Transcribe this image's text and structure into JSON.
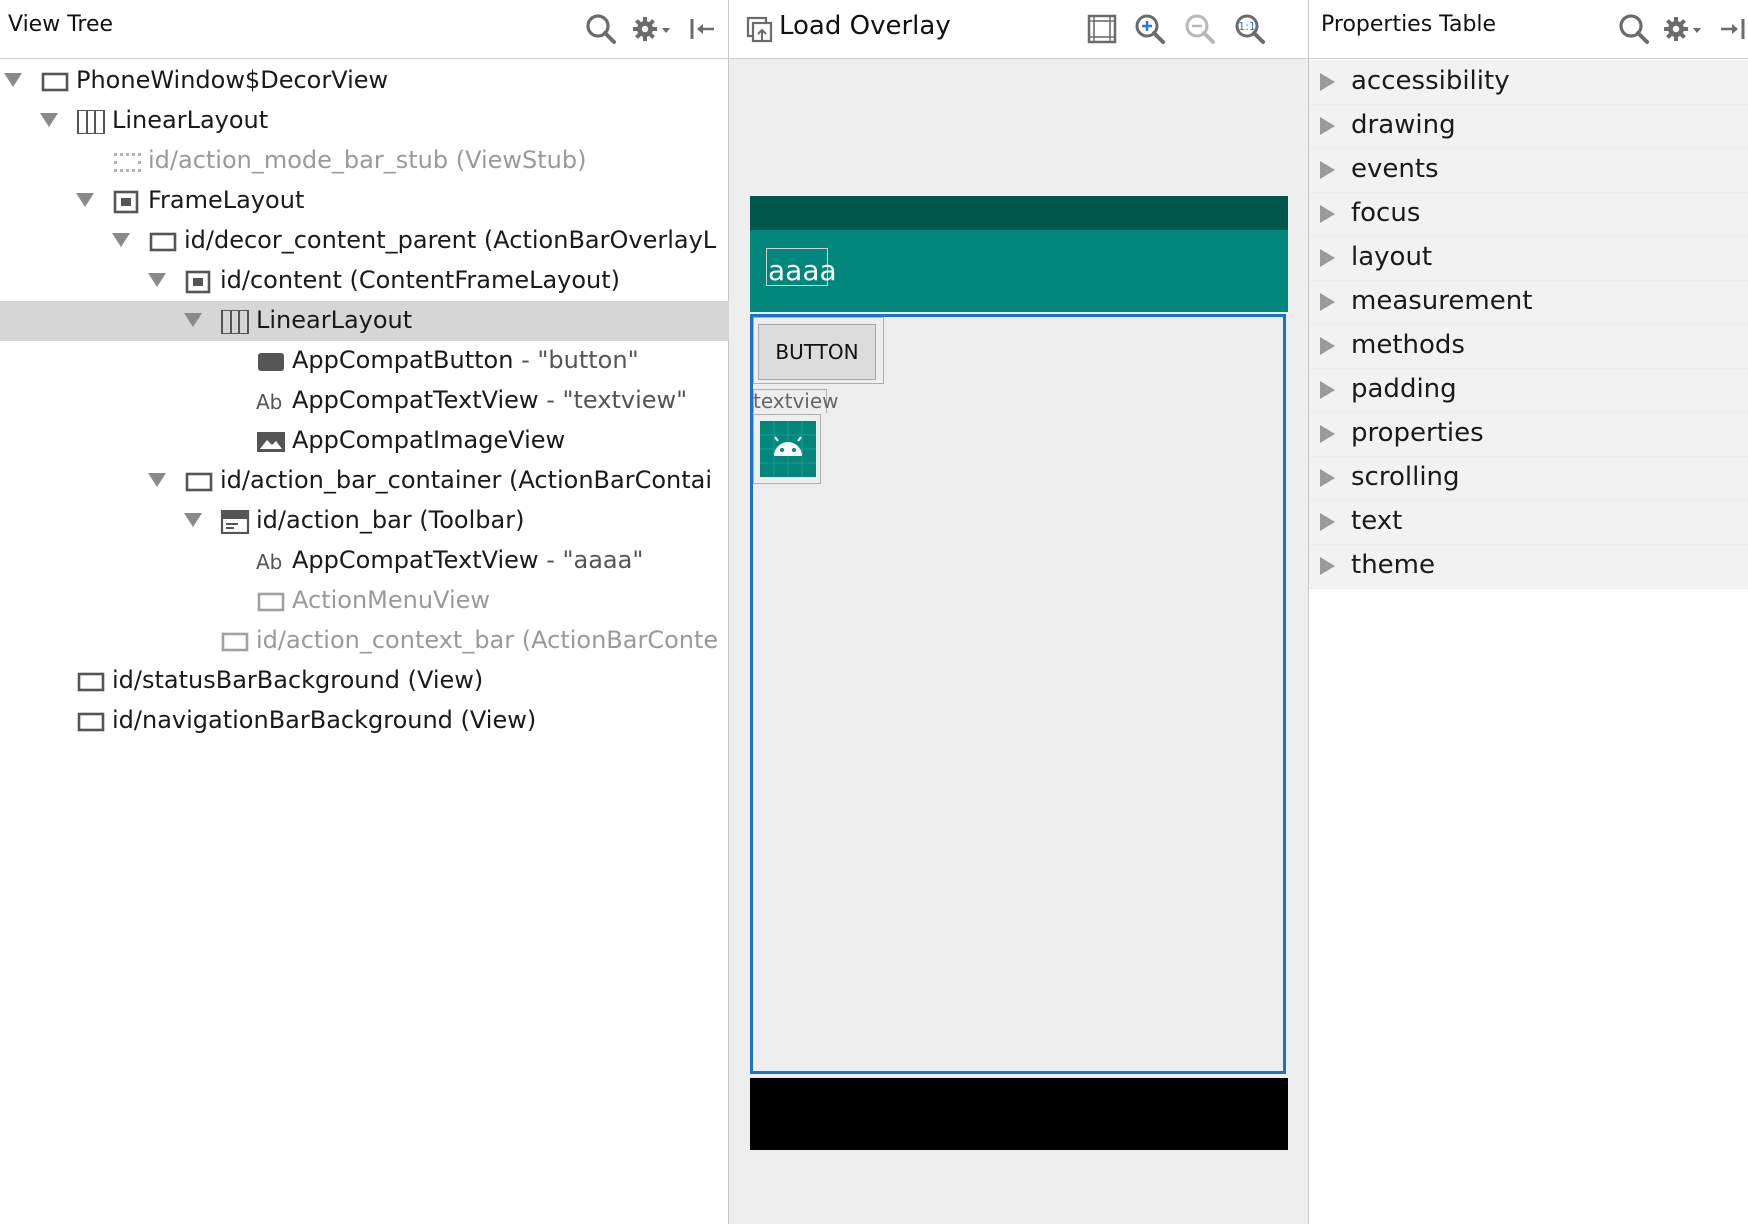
{
  "left_panel": {
    "title": "View Tree",
    "icons": [
      "search-icon",
      "gear-dropdown-icon",
      "collapse-left-icon"
    ],
    "tree": [
      {
        "label": "PhoneWindow$DecorView",
        "extra": "",
        "icon": "frame-icon",
        "expanded": true,
        "dim": false
      },
      {
        "label": "LinearLayout",
        "extra": "",
        "icon": "linear-layout-icon",
        "expanded": true,
        "dim": false
      },
      {
        "label": "id/action_mode_bar_stub (ViewStub)",
        "extra": "",
        "icon": "viewstub-icon",
        "expanded": false,
        "dim": true
      },
      {
        "label": "FrameLayout",
        "extra": "",
        "icon": "framelayout-icon",
        "expanded": true,
        "dim": false
      },
      {
        "label": "id/decor_content_parent (ActionBarOverlayL",
        "extra": "",
        "icon": "frame-icon",
        "expanded": true,
        "dim": false
      },
      {
        "label": "id/content (ContentFrameLayout)",
        "extra": "",
        "icon": "framelayout-icon",
        "expanded": true,
        "dim": false
      },
      {
        "label": "LinearLayout",
        "extra": "",
        "icon": "linear-layout-icon",
        "expanded": true,
        "dim": false,
        "selected": true
      },
      {
        "label": "AppCompatButton",
        "extra": " - \"button\"",
        "icon": "button-icon",
        "expanded": false,
        "dim": false
      },
      {
        "label": "AppCompatTextView",
        "extra": " - \"textview\"",
        "icon": "textview-icon",
        "expanded": false,
        "dim": false
      },
      {
        "label": "AppCompatImageView",
        "extra": "",
        "icon": "image-icon",
        "expanded": false,
        "dim": false
      },
      {
        "label": "id/action_bar_container (ActionBarContai",
        "extra": "",
        "icon": "frame-icon",
        "expanded": true,
        "dim": false
      },
      {
        "label": "id/action_bar (Toolbar)",
        "extra": "",
        "icon": "toolbar-icon",
        "expanded": true,
        "dim": false
      },
      {
        "label": "AppCompatTextView",
        "extra": " - \"aaaa\"",
        "icon": "textview-icon",
        "expanded": false,
        "dim": false
      },
      {
        "label": "ActionMenuView",
        "extra": "",
        "icon": "frame-icon",
        "expanded": false,
        "dim": true
      },
      {
        "label": "id/action_context_bar (ActionBarConte",
        "extra": "",
        "icon": "frame-icon",
        "expanded": false,
        "dim": true
      },
      {
        "label": "id/statusBarBackground (View)",
        "extra": "",
        "icon": "frame-icon",
        "expanded": false,
        "dim": false
      },
      {
        "label": "id/navigationBarBackground (View)",
        "extra": "",
        "icon": "frame-icon",
        "expanded": false,
        "dim": false
      }
    ],
    "textview_glyph": "Ab"
  },
  "center_panel": {
    "title": "Load Overlay",
    "icons": [
      "load-overlay-icon",
      "fit-screen-icon",
      "zoom-in-icon",
      "zoom-out-icon",
      "actual-size-icon"
    ],
    "actual_size_label": "1:1",
    "device": {
      "appbar_title": "aaaa",
      "button_label": "BUTTON",
      "textview_text": "textview",
      "colors": {
        "status_bar": "#00564b",
        "app_bar": "#00867a",
        "selection_border": "#1a73c6",
        "nav_bar": "#000000"
      }
    }
  },
  "right_panel": {
    "title": "Properties Table",
    "icons": [
      "search-icon",
      "gear-dropdown-icon",
      "collapse-right-icon"
    ],
    "categories": [
      "accessibility",
      "drawing",
      "events",
      "focus",
      "layout",
      "measurement",
      "methods",
      "padding",
      "properties",
      "scrolling",
      "text",
      "theme"
    ]
  }
}
